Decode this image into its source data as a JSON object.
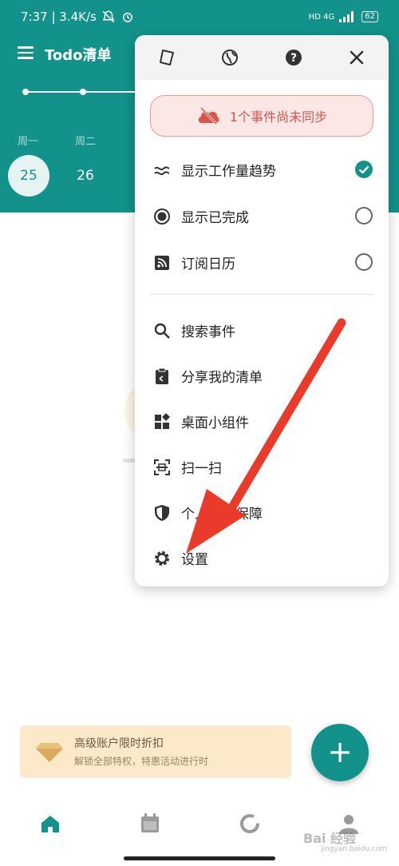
{
  "status_bar": {
    "time_speed": "7:37 | 3.4K/s",
    "network": "HD 4G",
    "battery": "62"
  },
  "header": {
    "title": "Todo清单",
    "weekdays": [
      "周一",
      "周二"
    ],
    "dates": [
      "25",
      "26"
    ]
  },
  "menu": {
    "sync_notice": "1个事件尚未同步",
    "toggles": [
      {
        "label": "显示工作量趋势",
        "checked": true
      },
      {
        "label": "显示已完成",
        "checked": false
      },
      {
        "label": "订阅日历",
        "checked": false
      }
    ],
    "actions": [
      {
        "label": "搜索事件"
      },
      {
        "label": "分享我的清单"
      },
      {
        "label": "桌面小组件"
      },
      {
        "label": "扫一扫"
      },
      {
        "label": "个人信息保障"
      },
      {
        "label": "设置"
      }
    ]
  },
  "promo": {
    "title": "高级账户限时折扣",
    "subtitle": "解锁全部特权，特惠活动进行时"
  },
  "fab_label": "+",
  "watermark": {
    "text": "Bai 经验",
    "sub": "jingyan.baidu.com"
  },
  "colors": {
    "accent": "#12928a",
    "danger": "#d9554a",
    "annotation_arrow": "#ea3a2a"
  }
}
